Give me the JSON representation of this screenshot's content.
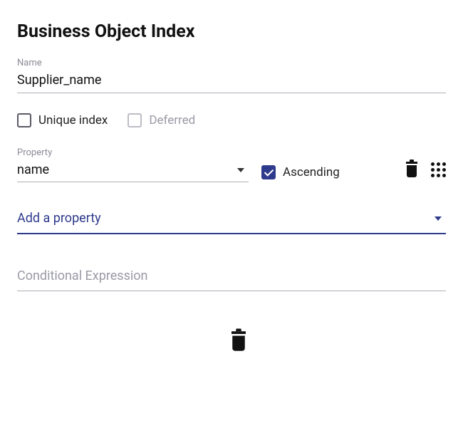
{
  "title": "Business Object Index",
  "name_field": {
    "label": "Name",
    "value": "Supplier_name"
  },
  "unique_index": {
    "label": "Unique index",
    "checked": false
  },
  "deferred": {
    "label": "Deferred",
    "checked": false
  },
  "property_row": {
    "label": "Property",
    "value": "name",
    "ascending": {
      "label": "Ascending",
      "checked": true
    }
  },
  "add_property": {
    "label": "Add a property"
  },
  "conditional_expression": {
    "placeholder": "Conditional Expression",
    "value": ""
  }
}
